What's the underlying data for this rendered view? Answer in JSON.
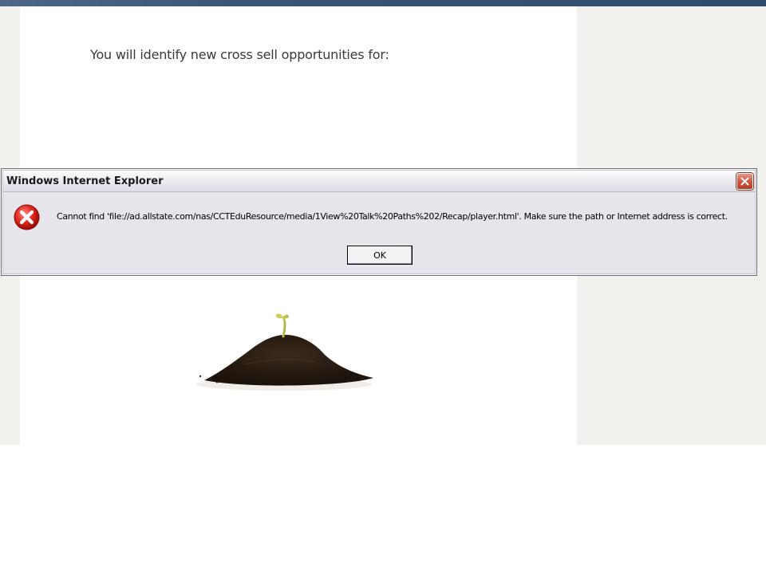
{
  "page": {
    "heading": "You will identify new cross sell opportunities for:"
  },
  "dialog": {
    "title": "Windows Internet Explorer",
    "message": "Cannot find 'file://ad.allstate.com/nas/CCTEduResource/media/1View%20Talk%20Paths%202/Recap/player.html'. Make sure the path or Internet address is correct.",
    "ok_label": "OK",
    "icon": "error-icon"
  },
  "colors": {
    "top_bar": "#3d5578",
    "page_background": "#f2f1ee",
    "content_panel": "#ffffff",
    "dialog_background": "#e6e5ec",
    "close_button": "#d0563f",
    "error_red": "#cc1414"
  }
}
